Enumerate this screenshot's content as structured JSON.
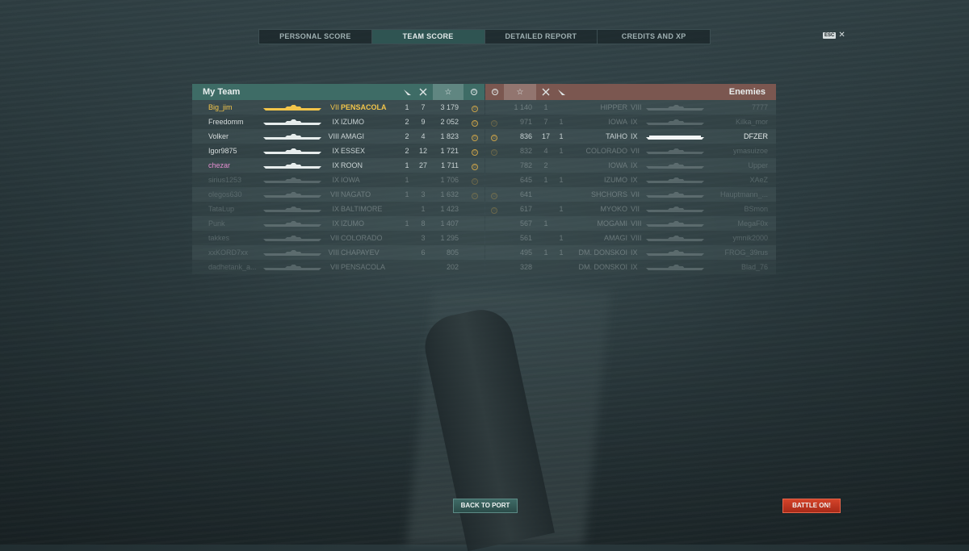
{
  "tabs": [
    "PERSONAL SCORE",
    "TEAM SCORE",
    "DETAILED REPORT",
    "CREDITS AND XP"
  ],
  "active_tab": 1,
  "esc": {
    "key": "ESC",
    "close": "✕"
  },
  "my_team": {
    "title": "My Team",
    "header_icons": [
      "plane-kill-icon",
      "ship-kill-icon",
      "score-star-icon",
      "achievement-icon"
    ],
    "rows": [
      {
        "player": "Big_jim",
        "tier": "VII",
        "ship": "PENSACOLA",
        "planes": "1",
        "kills": "7",
        "score": "3 179",
        "medal": true,
        "color": "#f3c54a",
        "state": "player"
      },
      {
        "player": "Freedomm",
        "tier": "IX",
        "ship": "IZUMO",
        "planes": "2",
        "kills": "9",
        "score": "2 052",
        "medal": true,
        "color": "#d6dcdc",
        "state": "alive"
      },
      {
        "player": "Volker",
        "tier": "VIII",
        "ship": "AMAGI",
        "planes": "2",
        "kills": "4",
        "score": "1 823",
        "medal": true,
        "color": "#d6dcdc",
        "state": "alive"
      },
      {
        "player": "Igor9875",
        "tier": "IX",
        "ship": "ESSEX",
        "planes": "2",
        "kills": "12",
        "score": "1 721",
        "medal": true,
        "color": "#d6dcdc",
        "state": "alive"
      },
      {
        "player": "chezar",
        "tier": "IX",
        "ship": "ROON",
        "planes": "1",
        "kills": "27",
        "score": "1 711",
        "medal": true,
        "color": "#e58fd1",
        "state": "alive"
      },
      {
        "player": "sirius1253",
        "tier": "IX",
        "ship": "IOWA",
        "planes": "1",
        "kills": "",
        "score": "1 706",
        "medal": true,
        "color": "#d6dcdc",
        "state": "dead"
      },
      {
        "player": "olegos630",
        "tier": "VII",
        "ship": "NAGATO",
        "planes": "1",
        "kills": "3",
        "score": "1 632",
        "medal": true,
        "color": "#d6dcdc",
        "state": "dead"
      },
      {
        "player": "TataLup",
        "tier": "IX",
        "ship": "BALTIMORE",
        "planes": "",
        "kills": "1",
        "score": "1 423",
        "medal": false,
        "color": "#d6dcdc",
        "state": "dead"
      },
      {
        "player": "Punk",
        "tier": "IX",
        "ship": "IZUMO",
        "planes": "1",
        "kills": "8",
        "score": "1 407",
        "medal": false,
        "color": "#d6dcdc",
        "state": "dead"
      },
      {
        "player": "takkes",
        "tier": "VII",
        "ship": "COLORADO",
        "planes": "",
        "kills": "3",
        "score": "1 295",
        "medal": false,
        "color": "#d6dcdc",
        "state": "dead"
      },
      {
        "player": "xxKORD7xx",
        "tier": "VIII",
        "ship": "CHAPAYEV",
        "planes": "",
        "kills": "6",
        "score": "805",
        "medal": false,
        "color": "#d6dcdc",
        "state": "dead"
      },
      {
        "player": "dadhetank_a...",
        "tier": "VII",
        "ship": "PENSACOLA",
        "planes": "",
        "kills": "",
        "score": "202",
        "medal": false,
        "color": "#d6dcdc",
        "state": "dead"
      }
    ]
  },
  "enemies": {
    "title": "Enemies",
    "header_icons": [
      "achievement-icon",
      "score-star-icon",
      "ship-kill-icon",
      "plane-kill-icon"
    ],
    "rows": [
      {
        "medal": false,
        "score": "1 140",
        "kills": "1",
        "planes": "",
        "ship": "HIPPER",
        "tier": "VIII",
        "player": "7777",
        "state": "dead"
      },
      {
        "medal": true,
        "score": "971",
        "kills": "7",
        "planes": "1",
        "ship": "IOWA",
        "tier": "IX",
        "player": "Kilka_mor",
        "state": "dead"
      },
      {
        "medal": true,
        "score": "836",
        "kills": "17",
        "planes": "1",
        "ship": "TAIHO",
        "tier": "IX",
        "player": "DFZER",
        "state": "alive"
      },
      {
        "medal": true,
        "score": "832",
        "kills": "4",
        "planes": "1",
        "ship": "COLORADO",
        "tier": "VII",
        "player": "ymasuizoe",
        "state": "dead"
      },
      {
        "medal": false,
        "score": "782",
        "kills": "2",
        "planes": "",
        "ship": "IOWA",
        "tier": "IX",
        "player": "Upper",
        "state": "dead"
      },
      {
        "medal": false,
        "score": "645",
        "kills": "1",
        "planes": "1",
        "ship": "IZUMO",
        "tier": "IX",
        "player": "XAeZ",
        "state": "dead"
      },
      {
        "medal": true,
        "score": "641",
        "kills": "",
        "planes": "",
        "ship": "SHCHORS",
        "tier": "VII",
        "player": "Hauptmann_...",
        "state": "dead"
      },
      {
        "medal": true,
        "score": "617",
        "kills": "",
        "planes": "1",
        "ship": "MYOKO",
        "tier": "VII",
        "player": "BSmon",
        "state": "dead"
      },
      {
        "medal": false,
        "score": "567",
        "kills": "1",
        "planes": "",
        "ship": "MOGAMI",
        "tier": "VIII",
        "player": "MegaF0x",
        "state": "dead"
      },
      {
        "medal": false,
        "score": "561",
        "kills": "",
        "planes": "1",
        "ship": "AMAGI",
        "tier": "VIII",
        "player": "ymnik2000",
        "state": "dead"
      },
      {
        "medal": false,
        "score": "495",
        "kills": "1",
        "planes": "1",
        "ship": "DM. DONSKOI",
        "tier": "IX",
        "player": "FROG_39rus",
        "state": "dead"
      },
      {
        "medal": false,
        "score": "328",
        "kills": "",
        "planes": "",
        "ship": "DM. DONSKOI",
        "tier": "IX",
        "player": "Blad_76",
        "state": "dead"
      }
    ]
  },
  "buttons": {
    "back": "BACK TO PORT",
    "battle": "BATTLE ON!"
  },
  "colors": {
    "team_header": "#3e6c66",
    "enemy_header": "#7b5750",
    "battle_button": "#c43a22",
    "player_highlight": "#f3c54a"
  }
}
